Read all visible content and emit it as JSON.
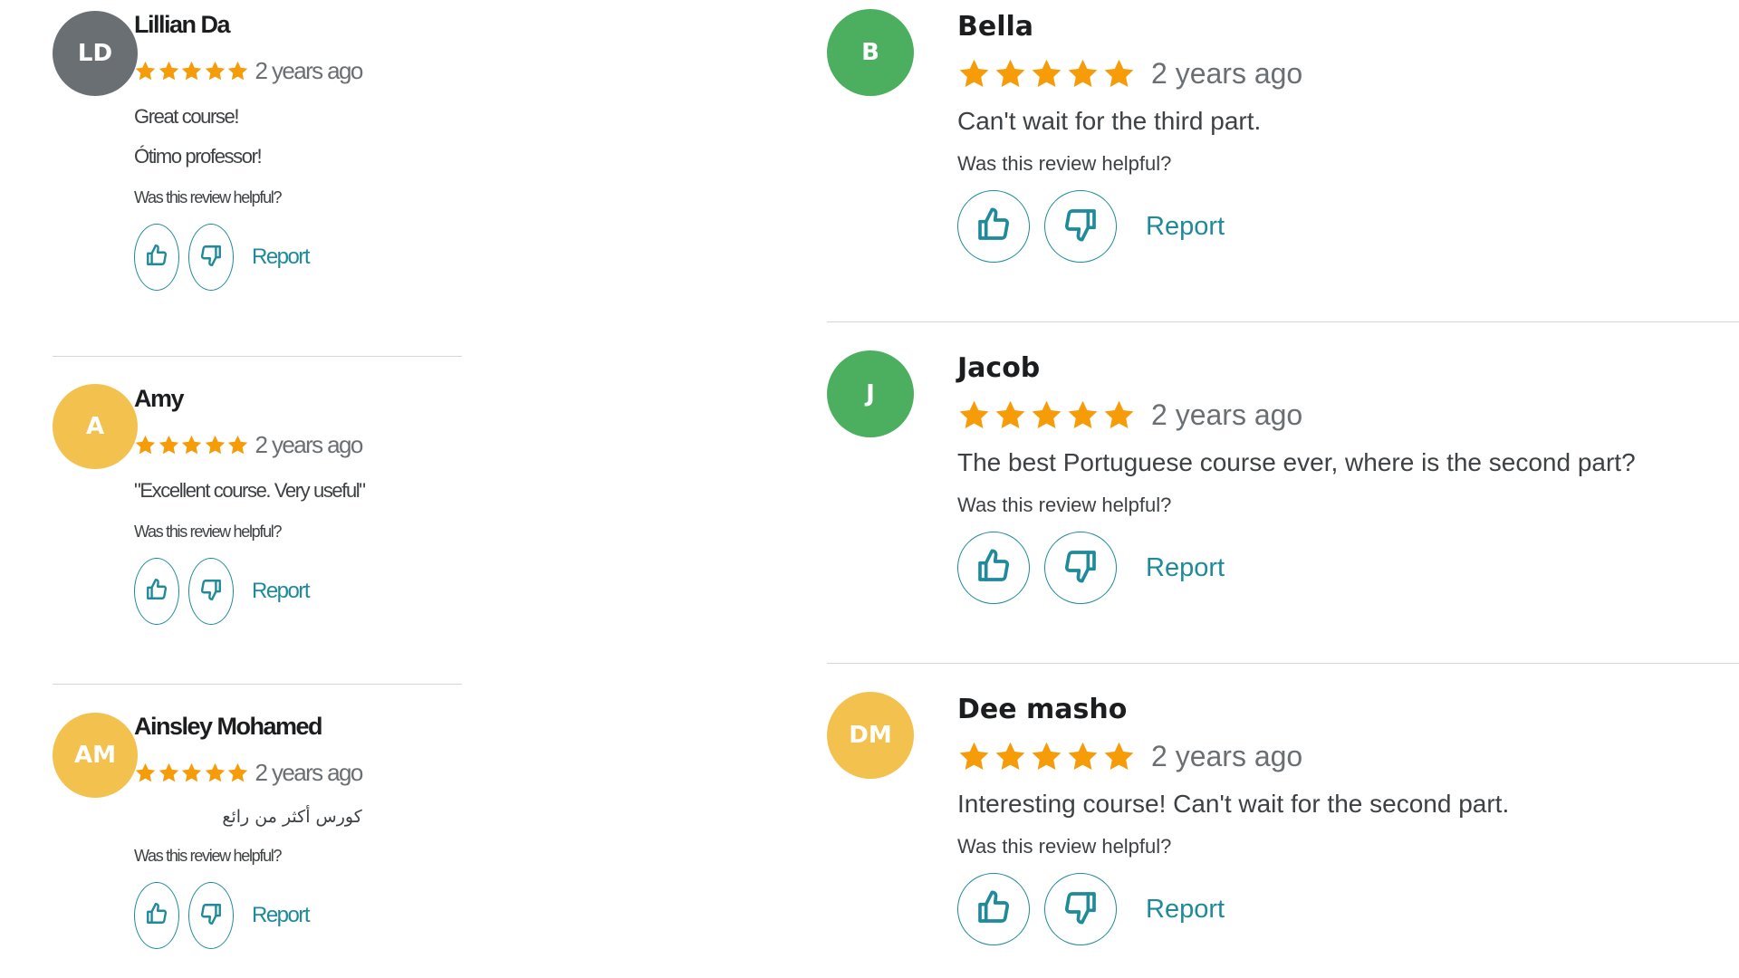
{
  "colors": {
    "star": "#f69c08",
    "link": "#1e8a9a",
    "divider": "#d1d7dc"
  },
  "icons": {
    "rating": "star-icon",
    "helpful_yes": "thumbs-up-icon",
    "helpful_no": "thumbs-down-icon"
  },
  "left_reviews": [
    {
      "initials": "LD",
      "avatar_color": "#6a6f73",
      "name": "Lillian Da",
      "rating": 5,
      "time": "2 years ago",
      "lines": [
        "Great course!",
        "Ótimo professor!"
      ],
      "helpful_prompt": "Was this review helpful?",
      "report_label": "Report"
    },
    {
      "initials": "A",
      "avatar_color": "#f2c14e",
      "name": "Amy",
      "rating": 5,
      "time": "2 years ago",
      "lines": [
        "\"Excellent course. Very useful\""
      ],
      "helpful_prompt": "Was this review helpful?",
      "report_label": "Report"
    },
    {
      "initials": "AM",
      "avatar_color": "#f2c14e",
      "name": "Ainsley Mohamed",
      "rating": 5,
      "time": "2 years ago",
      "lines": [
        "كورس أكثر من رائع"
      ],
      "helpful_prompt": "Was this review helpful?",
      "report_label": "Report"
    }
  ],
  "right_reviews": [
    {
      "initials": "B",
      "avatar_color": "#4caf60",
      "name": "Bella",
      "rating": 5,
      "time": "2 years ago",
      "lines": [
        "Can't wait for the third part."
      ],
      "helpful_prompt": "Was this review helpful?",
      "report_label": "Report"
    },
    {
      "initials": "J",
      "avatar_color": "#4caf60",
      "name": "Jacob",
      "rating": 5,
      "time": "2 years ago",
      "lines": [
        "The best Portuguese course ever, where is the second part?"
      ],
      "helpful_prompt": "Was this review helpful?",
      "report_label": "Report"
    },
    {
      "initials": "DM",
      "avatar_color": "#f2c14e",
      "name": "Dee masho",
      "rating": 5,
      "time": "2 years ago",
      "lines": [
        "Interesting course! Can't wait for the second part."
      ],
      "helpful_prompt": "Was this review helpful?",
      "report_label": "Report"
    }
  ]
}
